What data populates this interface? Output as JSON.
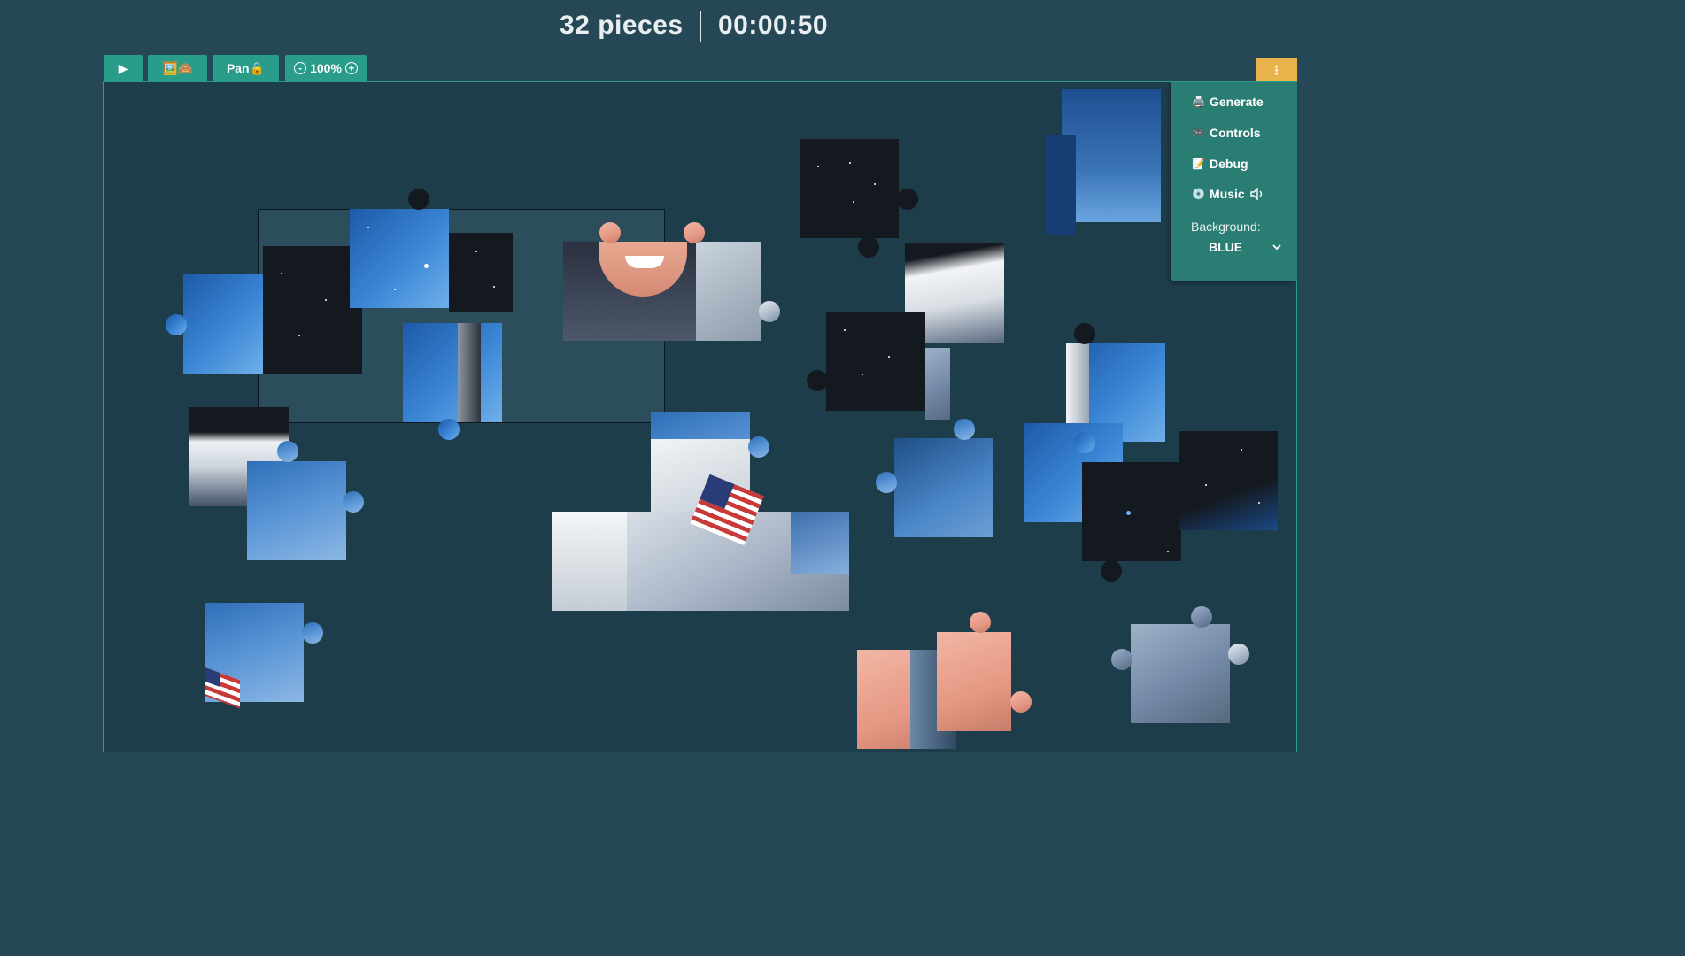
{
  "header": {
    "piece_count": "32 pieces",
    "timer": "00:00:50"
  },
  "toolbar": {
    "play_label": "▶",
    "preview_label": "🖼️🙈",
    "pan_label": "Pan🔒",
    "zoom_out": "-",
    "zoom_level": "100%",
    "zoom_in": "+",
    "menu_label": "⋮"
  },
  "menu": {
    "items": [
      {
        "icon": "🖨️",
        "label": "Generate"
      },
      {
        "icon": "🎮",
        "label": "Controls"
      },
      {
        "icon": "📝",
        "label": "Debug"
      },
      {
        "icon": "💿",
        "label": "Music"
      }
    ],
    "music_icon": "speaker-muted-icon",
    "background_label": "Background:",
    "background_value": "BLUE"
  },
  "colors": {
    "page_bg": "#264755",
    "board_bg": "#1e3d4b",
    "accent": "#2a9d8a",
    "menu_button": "#e9b44c",
    "menu_panel": "#2a7d73"
  }
}
